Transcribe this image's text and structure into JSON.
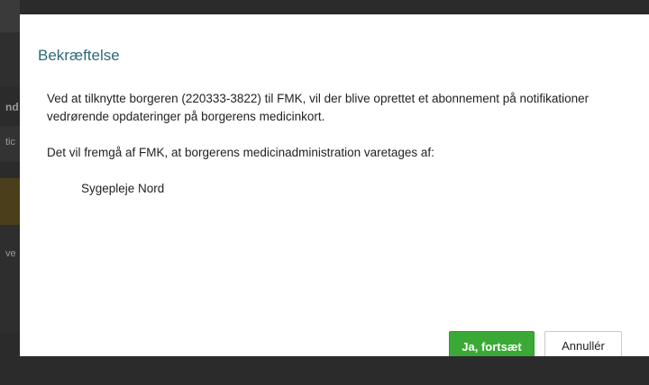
{
  "background": {
    "glyphs": [
      "nd",
      "tic",
      "ve"
    ]
  },
  "dialog": {
    "title": "Bekræftelse",
    "paragraph_1": "Ved at tilknytte borgeren (220333-3822) til FMK, vil der blive oprettet et abonnement på notifikationer vedrørende opdateringer på borgerens medicinkort.",
    "paragraph_2": "Det vil fremgå af FMK, at borgerens medicinadministration varetages af:",
    "recipient": "Sygepleje Nord",
    "confirm_label": "Ja, fortsæt",
    "cancel_label": "Annullér"
  },
  "colors": {
    "title": "#2e6a78",
    "confirm_bg": "#3aa935",
    "backdrop": "#2b2b2b"
  }
}
